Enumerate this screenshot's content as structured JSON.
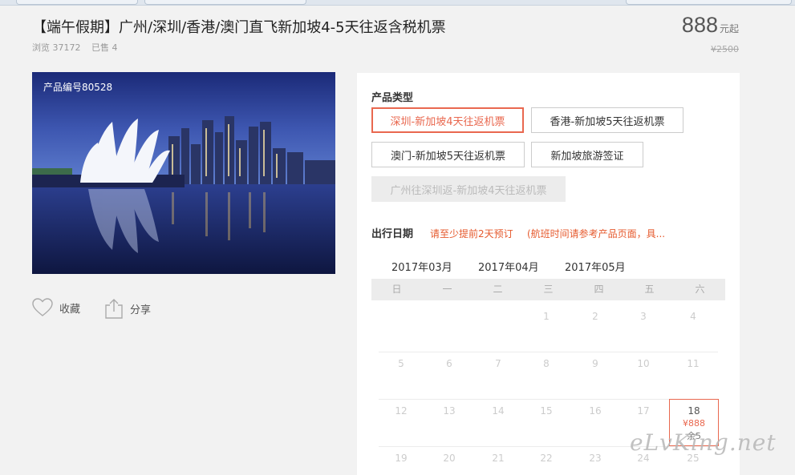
{
  "product": {
    "title": "【端午假期】广州/深圳/香港/澳门直飞新加坡4-5天往返含税机票",
    "views_label": "浏览 37172",
    "sold_label": "已售 4",
    "price": "888",
    "price_unit": "元起",
    "original_price": "¥2500",
    "code_label": "产品编号80528"
  },
  "actions": {
    "favorite": "收藏",
    "share": "分享"
  },
  "product_type": {
    "label": "产品类型",
    "options": [
      "深圳-新加坡4天往返机票",
      "香港-新加坡5天往返机票",
      "澳门-新加坡5天往返机票",
      "新加坡旅游签证",
      "广州往深圳返-新加坡4天往返机票"
    ],
    "selected_index": 0,
    "disabled_index": 4
  },
  "departure": {
    "label": "出行日期",
    "notice1": "请至少提前2天预订",
    "notice2": "(航班时间请参考产品页面，具..."
  },
  "calendar": {
    "months": [
      "2017年03月",
      "2017年04月",
      "2017年05月"
    ],
    "active_month": 0,
    "weekdays": [
      "日",
      "一",
      "二",
      "三",
      "四",
      "五",
      "六"
    ],
    "rows": [
      [
        "",
        "",
        "",
        "1",
        "2",
        "3",
        "4"
      ],
      [
        "5",
        "6",
        "7",
        "8",
        "9",
        "10",
        "11"
      ],
      [
        "12",
        "13",
        "14",
        "15",
        "16",
        "17",
        ""
      ],
      [
        "19",
        "20",
        "21",
        "22",
        "23",
        "24",
        "25"
      ]
    ],
    "highlight": {
      "day": "18",
      "price": "¥888",
      "remaining": "余5"
    }
  },
  "watermark": "eLvKing.net",
  "colors": {
    "accent": "#e9684f",
    "notice": "#e65a2e",
    "background": "#f2f2f2"
  }
}
